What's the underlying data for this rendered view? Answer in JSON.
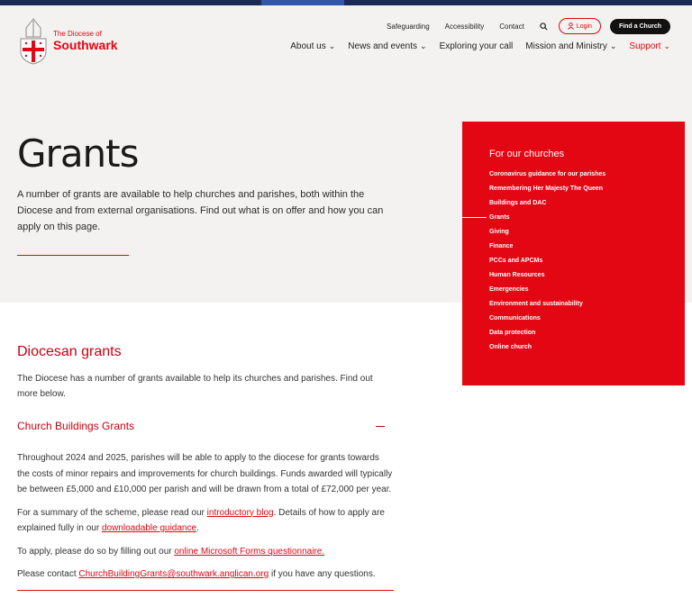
{
  "logo": {
    "line1": "The Diocese of",
    "line2": "Southwark"
  },
  "utility_nav": {
    "links": [
      "Safeguarding",
      "Accessibility",
      "Contact"
    ],
    "login_label": "Login",
    "find_church_label": "Find a Church"
  },
  "main_nav": [
    {
      "label": "About us",
      "has_dropdown": true
    },
    {
      "label": "News and events",
      "has_dropdown": true
    },
    {
      "label": "Exploring your call",
      "has_dropdown": false
    },
    {
      "label": "Mission and Ministry",
      "has_dropdown": true
    },
    {
      "label": "Support",
      "has_dropdown": true,
      "active": true
    }
  ],
  "hero": {
    "title": "Grants",
    "description": "A number of grants are available to help churches and parishes, both within the Diocese and from external organisations. Find out what is on offer and how you can apply on this page."
  },
  "sidebar": {
    "heading": "For our churches",
    "items": [
      "Coronavirus guidance for our parishes",
      "Remembering Her Majesty The Queen",
      "Buildings and DAC",
      "Grants",
      "Giving",
      "Finance",
      "PCCs and APCMs",
      "Human Resources",
      "Emergencies",
      "Environment and sustainability",
      "Communications",
      "Data protection",
      "Online church"
    ],
    "current": "Grants"
  },
  "content": {
    "heading": "Diocesan grants",
    "intro": "The Diocese has a number of grants available to help its churches and parishes. Find out more below.",
    "accordion_title": "Church Buildings Grants",
    "para1": "Throughout 2024 and 2025, parishes will be able to apply to the diocese for grants towards the costs of minor repairs and improvements for church buildings. Funds awarded will typically be between £5,000 and £10,000 per parish and will be drawn from a total of £72,000 per year.",
    "para2": {
      "text_a": "For a summary of the scheme, please read our ",
      "link_a": "introductory blog",
      "text_b": ". Details of how to apply are explained fully in our ",
      "link_b": "downloadable guidance",
      "text_c": "."
    },
    "para3": {
      "text_a": "To apply, please do so by filling out our ",
      "link_a": "online Microsoft Forms questionnaire."
    },
    "para4": {
      "text_a": "Please contact ",
      "link_a": "ChurchBuildingGrants@southwark.anglican.org",
      "text_b": " if you have any questions."
    }
  },
  "colors": {
    "brand_red": "#e30613",
    "navy": "#1b2a55",
    "hero_bg": "#f3f2f0"
  }
}
